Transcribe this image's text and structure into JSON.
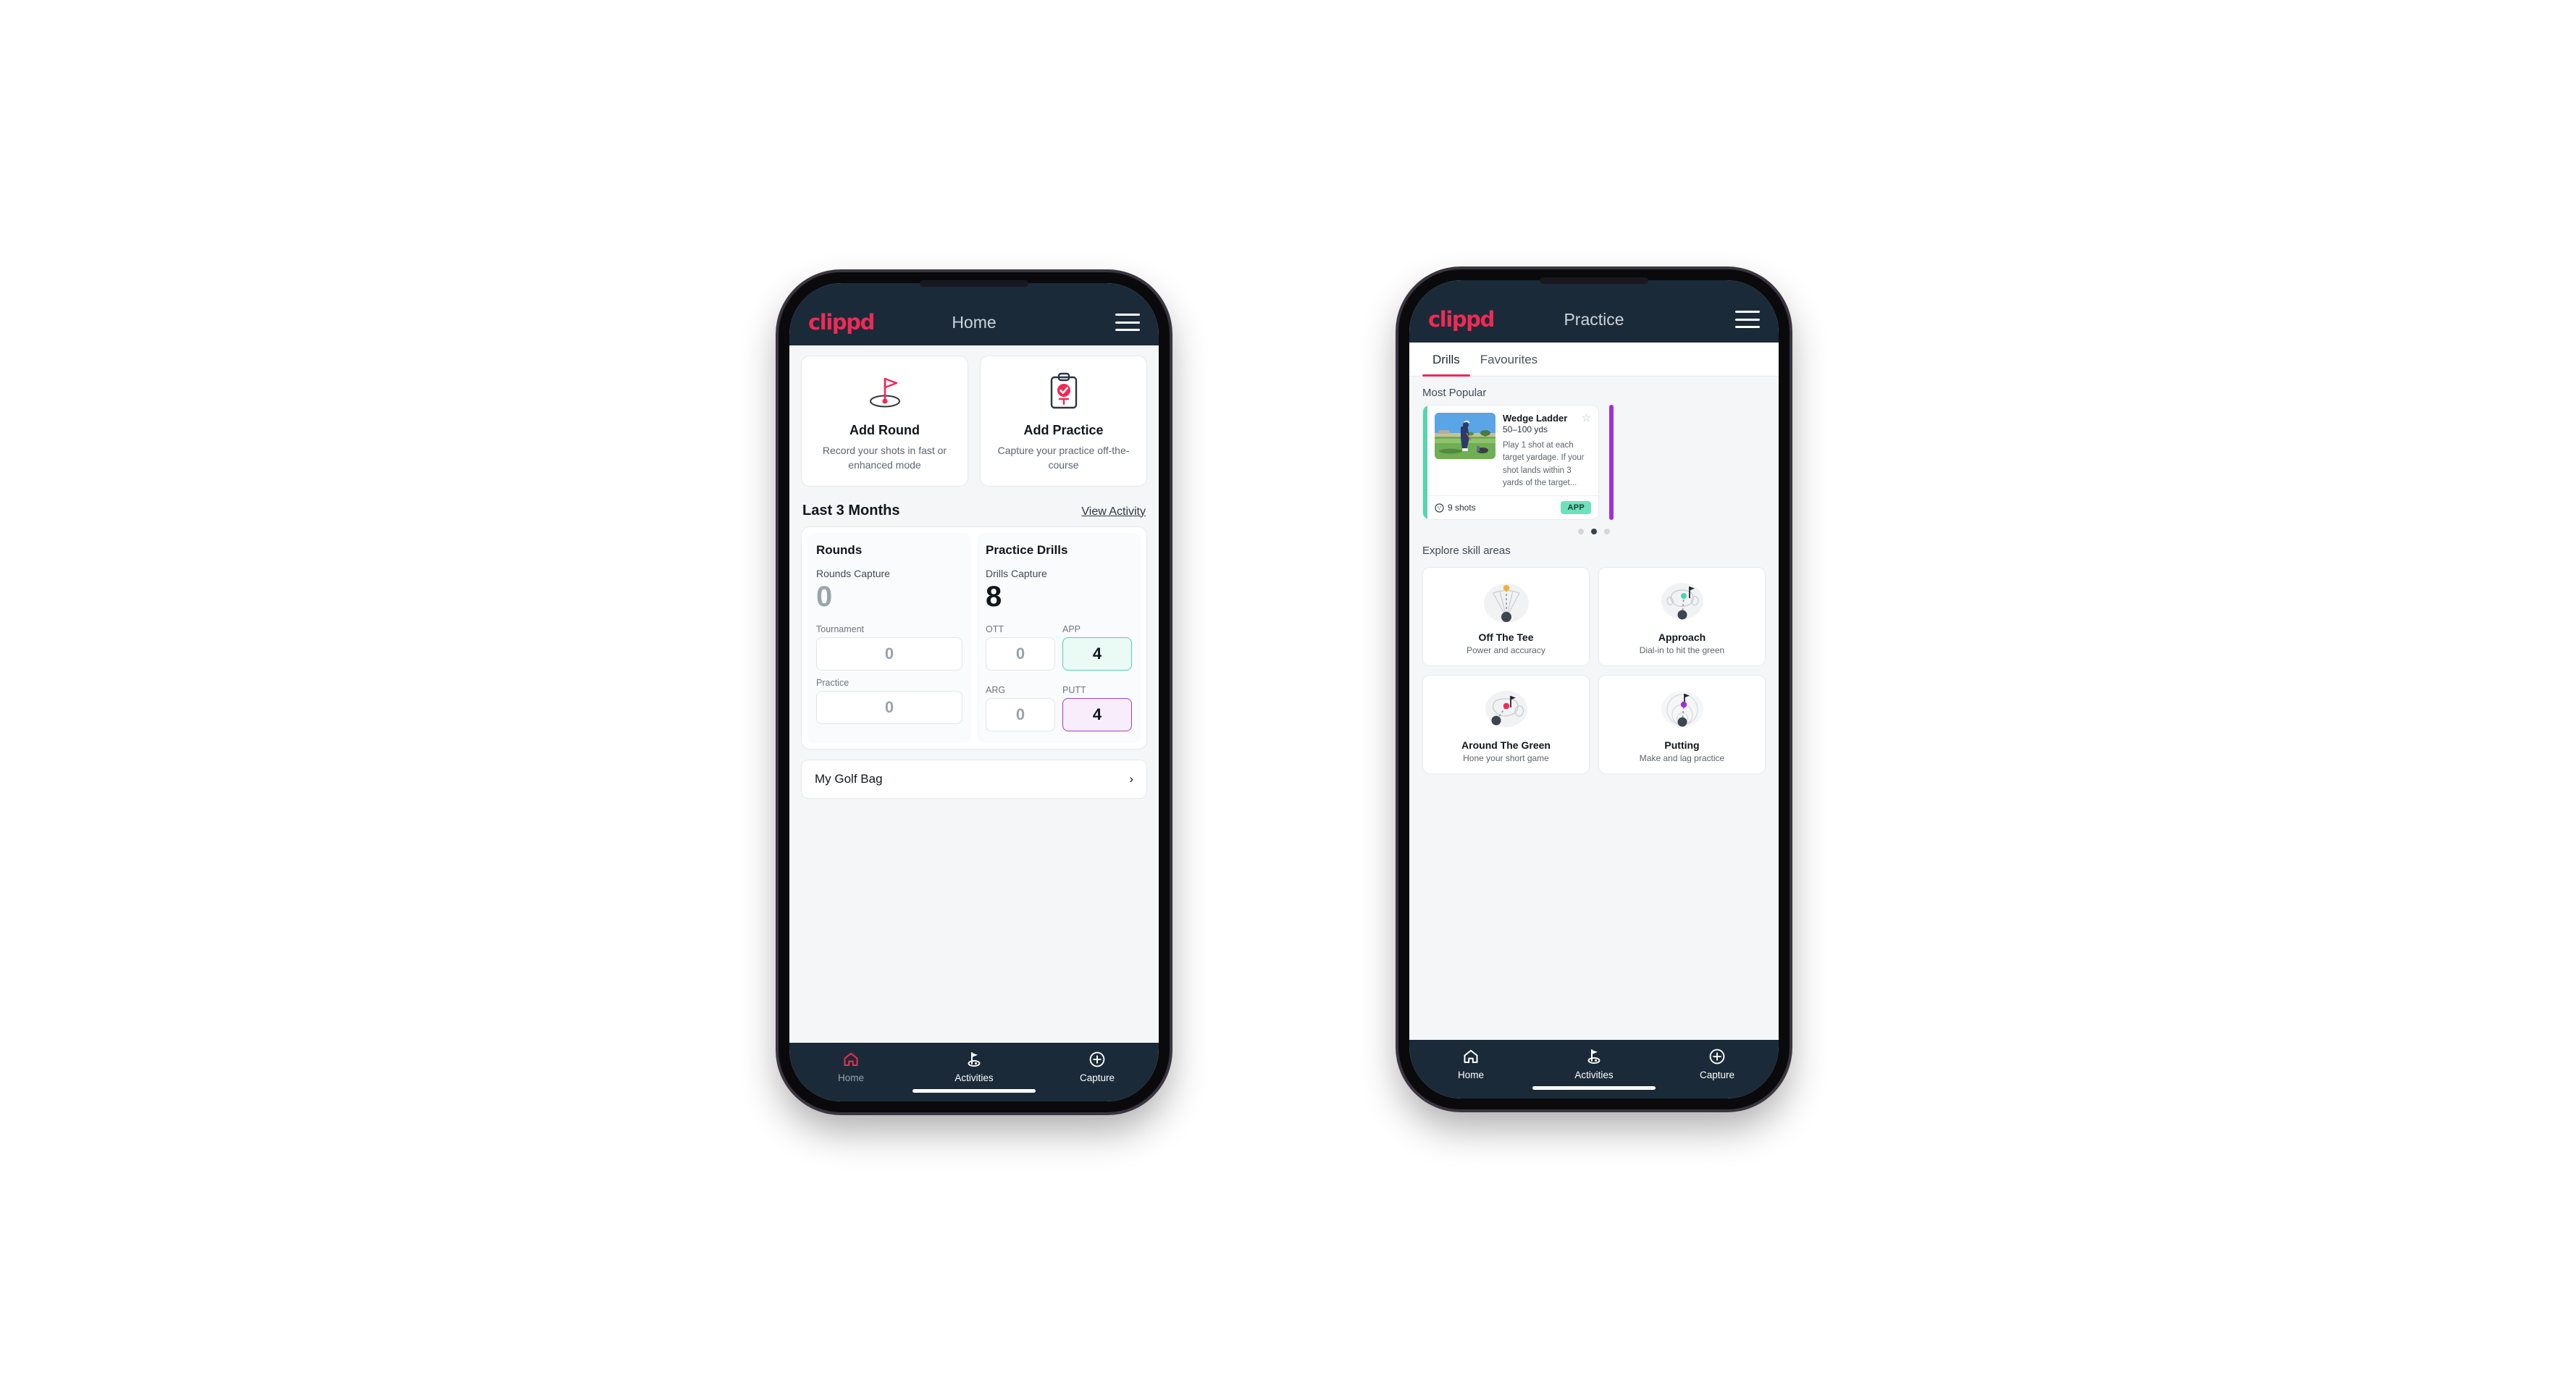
{
  "brand": {
    "name": "clippd",
    "color": "#ee2b55"
  },
  "theme": {
    "header_bg": "#1b2a38",
    "accent_pink": "#ee2b55",
    "accent_teal": "#55d6b0",
    "accent_purple": "#a22fd8",
    "page_bg": "#f5f6f8"
  },
  "phone_home": {
    "header": {
      "title": "Home",
      "menu_icon": "hamburger-icon"
    },
    "quick_actions": [
      {
        "icon": "golf-flag-hole-icon",
        "title": "Add Round",
        "subtitle": "Record your shots in fast or enhanced mode"
      },
      {
        "icon": "clipboard-check-icon",
        "title": "Add Practice",
        "subtitle": "Capture your practice off-the-course"
      }
    ],
    "section": {
      "title": "Last 3 Months",
      "link": "View Activity"
    },
    "rounds": {
      "heading": "Rounds",
      "capture_label": "Rounds Capture",
      "capture_value": "0",
      "fields": [
        {
          "label": "Tournament",
          "value": "0"
        },
        {
          "label": "Practice",
          "value": "0"
        }
      ]
    },
    "practice_drills": {
      "heading": "Practice Drills",
      "capture_label": "Drills Capture",
      "capture_value": "8",
      "fields": [
        {
          "label": "OTT",
          "value": "0",
          "style": "plain"
        },
        {
          "label": "APP",
          "value": "4",
          "style": "app"
        },
        {
          "label": "ARG",
          "value": "0",
          "style": "plain"
        },
        {
          "label": "PUTT",
          "value": "4",
          "style": "putt"
        }
      ]
    },
    "golf_bag": {
      "label": "My Golf Bag",
      "chevron": "chevron-right-icon"
    },
    "nav": [
      {
        "icon": "home-icon",
        "label": "Home",
        "active": true
      },
      {
        "icon": "golf-flag-icon",
        "label": "Activities",
        "active": false
      },
      {
        "icon": "plus-circle-icon",
        "label": "Capture",
        "active": false
      }
    ]
  },
  "phone_practice": {
    "header": {
      "title": "Practice",
      "menu_icon": "hamburger-icon"
    },
    "tabs": [
      {
        "label": "Drills",
        "active": true
      },
      {
        "label": "Favourites",
        "active": false
      }
    ],
    "most_popular_label": "Most Popular",
    "drill_card": {
      "stripe_color": "#55d6b0",
      "thumbnail": "golfer-driving-range-photo",
      "title": "Wedge Ladder",
      "yardage": "50–100 yds",
      "description": "Play 1 shot at each target yardage. If your shot lands within 3 yards of the target...",
      "favourite_icon": "star-outline-icon",
      "shots_icon": "golf-ball-icon",
      "shots": "9 shots",
      "badge": "APP"
    },
    "carousel_dots": {
      "count": 3,
      "active_index": 1
    },
    "explore_label": "Explore skill areas",
    "skill_areas": [
      {
        "icon": "tee-shot-dispersion-icon",
        "title": "Off The Tee",
        "subtitle": "Power and accuracy"
      },
      {
        "icon": "approach-green-icon",
        "title": "Approach",
        "subtitle": "Dial-in to hit the green"
      },
      {
        "icon": "around-the-green-icon",
        "title": "Around The Green",
        "subtitle": "Hone your short game"
      },
      {
        "icon": "putting-rings-icon",
        "title": "Putting",
        "subtitle": "Make and lag practice"
      }
    ],
    "nav": [
      {
        "icon": "home-icon",
        "label": "Home",
        "active": false
      },
      {
        "icon": "golf-flag-icon",
        "label": "Activities",
        "active": true
      },
      {
        "icon": "plus-circle-icon",
        "label": "Capture",
        "active": false
      }
    ]
  }
}
